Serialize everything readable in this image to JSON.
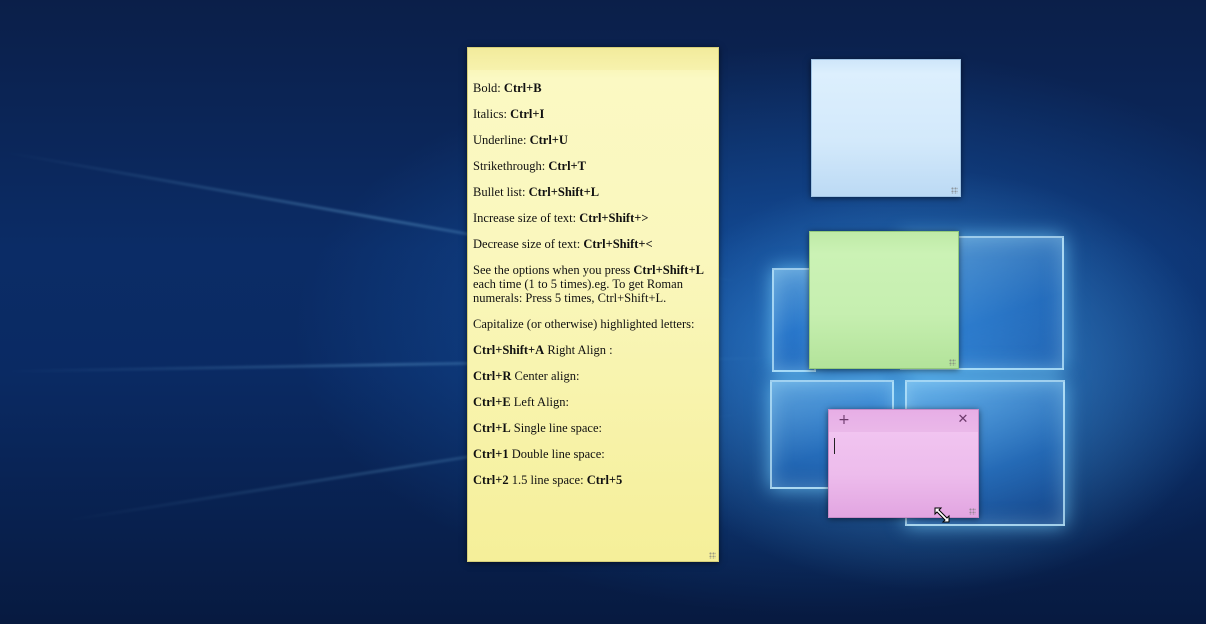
{
  "desktop": {
    "background": "Windows 10 hero wallpaper",
    "colors": {
      "dark_blue": "#0b2c66",
      "glow": "#5abeff"
    }
  },
  "notes": {
    "yellow": {
      "color": "#faf7bd",
      "lines": [
        {
          "t1": "Bold: ",
          "b1": "Ctrl+B"
        },
        {
          "t1": "Italics: ",
          "b1": "Ctrl+I"
        },
        {
          "t1": "Underline: ",
          "b1": "Ctrl+U"
        },
        {
          "t1": "Strikethrough: ",
          "b1": "Ctrl+T"
        },
        {
          "t1": "Bullet list: ",
          "b1": "Ctrl+Shift+L"
        },
        {
          "t1": "Increase size of text: ",
          "b1": "Ctrl+Shift+>"
        },
        {
          "t1": "Decrease size of text: ",
          "b1": "Ctrl+Shift+<"
        }
      ],
      "options": {
        "t1": "See the options when you press ",
        "b1": "Ctrl+Shift+L",
        "t2": " each time (1 to 5 times).eg. To get Roman numerals: Press 5 times, Ctrl+Shift+L."
      },
      "capitalize": "Capitalize (or otherwise) highlighted letters:",
      "shortcuts": [
        {
          "b1": "Ctrl+Shift+A",
          "t1": " Right Align :"
        },
        {
          "b1": "Ctrl+R",
          "t1": " Center align:"
        },
        {
          "b1": "Ctrl+E",
          "t1": " Left Align:"
        },
        {
          "b1": "Ctrl+L",
          "t1": " Single line space:"
        },
        {
          "b1": "Ctrl+1",
          "t1": " Double line space:"
        }
      ],
      "last": {
        "b1": "Ctrl+2",
        "t1": " 1.5 line space: ",
        "b2": "Ctrl+5"
      }
    },
    "blue": {
      "color": "#d3e9fb"
    },
    "green": {
      "color": "#c6efb0"
    },
    "pink": {
      "color": "#edbcec",
      "add_icon": "+",
      "close_icon": "✕"
    }
  },
  "cursor": {
    "icon": "resize-diagonal-cursor"
  }
}
